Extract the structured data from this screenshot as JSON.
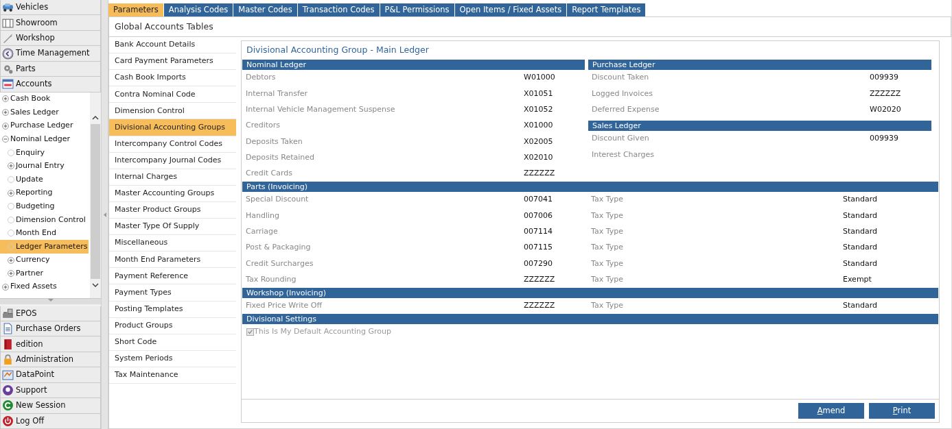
{
  "sidebar": {
    "top_buttons": [
      {
        "label": "Vehicles"
      },
      {
        "label": "Showroom"
      },
      {
        "label": "Workshop"
      },
      {
        "label": "Time Management"
      },
      {
        "label": "Parts"
      },
      {
        "label": "Accounts"
      }
    ],
    "tree": [
      {
        "label": "Cash Book",
        "expanded": false,
        "selected": false
      },
      {
        "label": "Sales Ledger",
        "expanded": false,
        "selected": false
      },
      {
        "label": "Purchase Ledger",
        "expanded": false,
        "selected": false
      },
      {
        "label": "Nominal Ledger",
        "expanded": true,
        "selected": false,
        "children": [
          {
            "label": "Enquiry",
            "selected": false
          },
          {
            "label": "Journal Entry",
            "expanded": false,
            "selected": false
          },
          {
            "label": "Update",
            "selected": false
          },
          {
            "label": "Reporting",
            "expanded": false,
            "selected": false
          },
          {
            "label": "Budgeting",
            "selected": false
          },
          {
            "label": "Dimension Control",
            "selected": false
          },
          {
            "label": "Month End",
            "selected": false
          },
          {
            "label": "Ledger Parameters",
            "selected": true
          },
          {
            "label": "Currency",
            "expanded": false,
            "selected": false
          },
          {
            "label": "Partner",
            "expanded": false,
            "selected": false
          }
        ]
      },
      {
        "label": "Fixed Assets",
        "expanded": false,
        "selected": false
      }
    ],
    "bottom_buttons": [
      {
        "label": "EPOS"
      },
      {
        "label": "Purchase Orders"
      },
      {
        "label": "edition"
      },
      {
        "label": "Administration"
      },
      {
        "label": "DataPoint"
      },
      {
        "label": "Support"
      },
      {
        "label": "New Session"
      },
      {
        "label": "Log Off"
      }
    ]
  },
  "tabs": [
    {
      "label": "Parameters",
      "selected": true
    },
    {
      "label": "Analysis Codes",
      "selected": false
    },
    {
      "label": "Master Codes",
      "selected": false
    },
    {
      "label": "Transaction Codes",
      "selected": false
    },
    {
      "label": "P&L Permissions",
      "selected": false
    },
    {
      "label": "Open Items / Fixed Assets",
      "selected": false
    },
    {
      "label": "Report Templates",
      "selected": false
    }
  ],
  "page_title": "Global Accounts Tables",
  "tables_list": [
    {
      "label": "Bank Account Details",
      "selected": false
    },
    {
      "label": "Card Payment Parameters",
      "selected": false
    },
    {
      "label": "Cash Book Imports",
      "selected": false
    },
    {
      "label": "Contra Nominal Code",
      "selected": false
    },
    {
      "label": "Dimension Control",
      "selected": false
    },
    {
      "label": "Divisional Accounting Groups",
      "selected": true
    },
    {
      "label": "Intercompany Control Codes",
      "selected": false
    },
    {
      "label": "Intercompany Journal Codes",
      "selected": false
    },
    {
      "label": "Internal Charges",
      "selected": false
    },
    {
      "label": "Master Accounting Groups",
      "selected": false
    },
    {
      "label": "Master Product Groups",
      "selected": false
    },
    {
      "label": "Master Type Of Supply",
      "selected": false
    },
    {
      "label": "Miscellaneous",
      "selected": false
    },
    {
      "label": "Month End Parameters",
      "selected": false
    },
    {
      "label": "Payment Reference",
      "selected": false
    },
    {
      "label": "Payment Types",
      "selected": false
    },
    {
      "label": "Posting Templates",
      "selected": false
    },
    {
      "label": "Product Groups",
      "selected": false
    },
    {
      "label": "Short Code",
      "selected": false
    },
    {
      "label": "System Periods",
      "selected": false
    },
    {
      "label": "Tax Maintenance",
      "selected": false
    }
  ],
  "detail": {
    "title": "Divisional Accounting Group - Main Ledger",
    "nominal_ledger": {
      "heading": "Nominal Ledger",
      "rows": [
        {
          "label": "Debtors",
          "code": "W01000"
        },
        {
          "label": "Internal Transfer",
          "code": "X01051"
        },
        {
          "label": "Internal Vehicle Management Suspense",
          "code": "X01052"
        },
        {
          "label": "Creditors",
          "code": "X01000"
        },
        {
          "label": "Deposits Taken",
          "code": "X02005"
        },
        {
          "label": "Deposits Retained",
          "code": "X02010"
        },
        {
          "label": "Credit Cards",
          "code": "ZZZZZZ"
        }
      ]
    },
    "purchase_ledger": {
      "heading": "Purchase Ledger",
      "rows": [
        {
          "label": "Discount Taken",
          "code": "009939"
        },
        {
          "label": "Logged Invoices",
          "code": "ZZZZZZ"
        },
        {
          "label": "Deferred Expense",
          "code": "W02020"
        }
      ]
    },
    "sales_ledger": {
      "heading": "Sales Ledger",
      "rows": [
        {
          "label": "Discount Given",
          "code": "009939"
        },
        {
          "label": "Interest Charges"
        }
      ]
    },
    "parts": {
      "heading": "Parts (Invoicing)",
      "rows": [
        {
          "label": "Special Discount",
          "code": "007041",
          "tax_label": "Tax Type",
          "tax_type": "Standard"
        },
        {
          "label": "Handling",
          "code": "007006",
          "tax_label": "Tax Type",
          "tax_type": "Standard"
        },
        {
          "label": "Carriage",
          "code": "007114",
          "tax_label": "Tax Type",
          "tax_type": "Standard"
        },
        {
          "label": "Post & Packaging",
          "code": "007115",
          "tax_label": "Tax Type",
          "tax_type": "Standard"
        },
        {
          "label": "Credit Surcharges",
          "code": "007290",
          "tax_label": "Tax Type",
          "tax_type": "Standard"
        },
        {
          "label": "Tax Rounding",
          "code": "ZZZZZZ",
          "tax_label": "Tax Type",
          "tax_type": "Exempt"
        }
      ]
    },
    "workshop": {
      "heading": "Workshop (Invoicing)",
      "rows": [
        {
          "label": "Fixed Price Write Off",
          "code": "ZZZZZZ",
          "tax_label": "Tax Type",
          "tax_type": "Standard"
        }
      ]
    },
    "divisional_settings": {
      "heading": "Divisional Settings",
      "checkbox": {
        "label": "This Is My Default Accounting Group",
        "checked": true,
        "disabled": true
      }
    },
    "buttons": [
      {
        "label": "Amend"
      },
      {
        "label": "Print"
      }
    ]
  }
}
